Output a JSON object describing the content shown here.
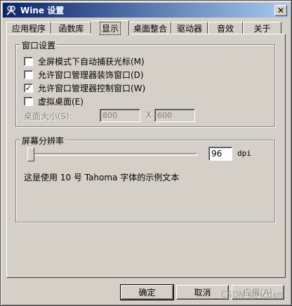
{
  "window": {
    "title": "Wine 设置",
    "close_glyph": "✕"
  },
  "tabs": [
    {
      "label": "应用程序"
    },
    {
      "label": "函数库"
    },
    {
      "label": "显示",
      "active": true
    },
    {
      "label": "桌面整合"
    },
    {
      "label": "驱动器"
    },
    {
      "label": "音效"
    },
    {
      "label": "关于"
    }
  ],
  "window_settings": {
    "title": "窗口设置",
    "options": [
      {
        "label": "全屏模式下自动捕获光标(M)",
        "checked": false
      },
      {
        "label": "允许窗口管理器装饰窗口(D)",
        "checked": false
      },
      {
        "label": "允许窗口管理器控制窗口(W)",
        "checked": true
      },
      {
        "label": "虚拟桌面(E)",
        "checked": false
      }
    ],
    "desktop_size_label": "桌面大小(S):",
    "width": "800",
    "separator": "X",
    "height": "600"
  },
  "resolution": {
    "title": "屏幕分辨率",
    "dpi_value": "96",
    "dpi_unit": "dpi",
    "slider_level": 0.0,
    "sample_text": "这是使用 10 号 Tahoma 字体的示例文本"
  },
  "buttons": {
    "ok": "确定",
    "cancel": "取消",
    "apply": "应用(A)"
  },
  "watermark": "CSDN @Hcden",
  "colors": {
    "titlebar_start": "#0a246a",
    "titlebar_end": "#a6caf0",
    "face": "#d4d0c8"
  }
}
